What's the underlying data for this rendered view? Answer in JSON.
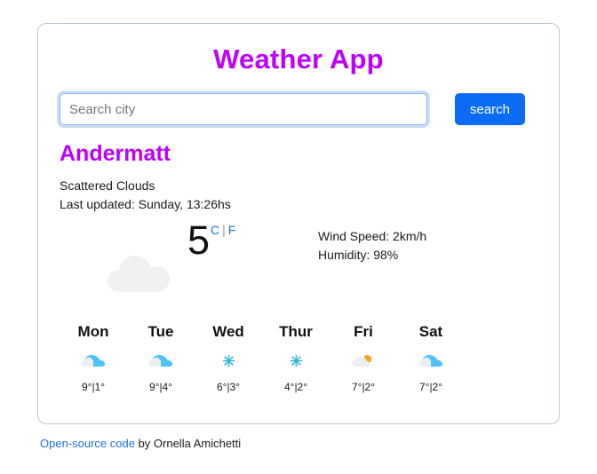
{
  "app": {
    "title": "Weather App"
  },
  "search": {
    "placeholder": "Search city",
    "value": "",
    "button_label": "search"
  },
  "current": {
    "city": "Andermatt",
    "condition": "Scattered Clouds",
    "last_updated": "Last updated: Sunday, 13:26hs",
    "temperature": "5",
    "unit_celsius": "C",
    "unit_separator": "|",
    "unit_fahrenheit": "F",
    "icon": "cloud-icon",
    "wind": "Wind Speed: 2km/h",
    "humidity": "Humidity: 98%"
  },
  "forecast": [
    {
      "day": "Mon",
      "icon": "cloud-icon",
      "temps": "9°|1°"
    },
    {
      "day": "Tue",
      "icon": "cloud-icon",
      "temps": "9°|4°"
    },
    {
      "day": "Wed",
      "icon": "snowflake-icon",
      "temps": "6°|3°"
    },
    {
      "day": "Thur",
      "icon": "snowflake-icon",
      "temps": "4°|2°"
    },
    {
      "day": "Fri",
      "icon": "sun-cloud-icon",
      "temps": "7°|2°"
    },
    {
      "day": "Sat",
      "icon": "cloud-icon",
      "temps": "7°|2°"
    }
  ],
  "footer": {
    "link_text": "Open-source code",
    "credit": " by Ornella Amichetti"
  },
  "colors": {
    "title_purple": "#bf00ff",
    "button_blue": "#0c6bf5",
    "link_blue": "#1a73e8",
    "cloud_gray": "#f0f0ee",
    "forecast_cloud_blue": "#4fc3f7",
    "snowflake_blue": "#29b6d6",
    "sun_orange": "#f5a623"
  }
}
